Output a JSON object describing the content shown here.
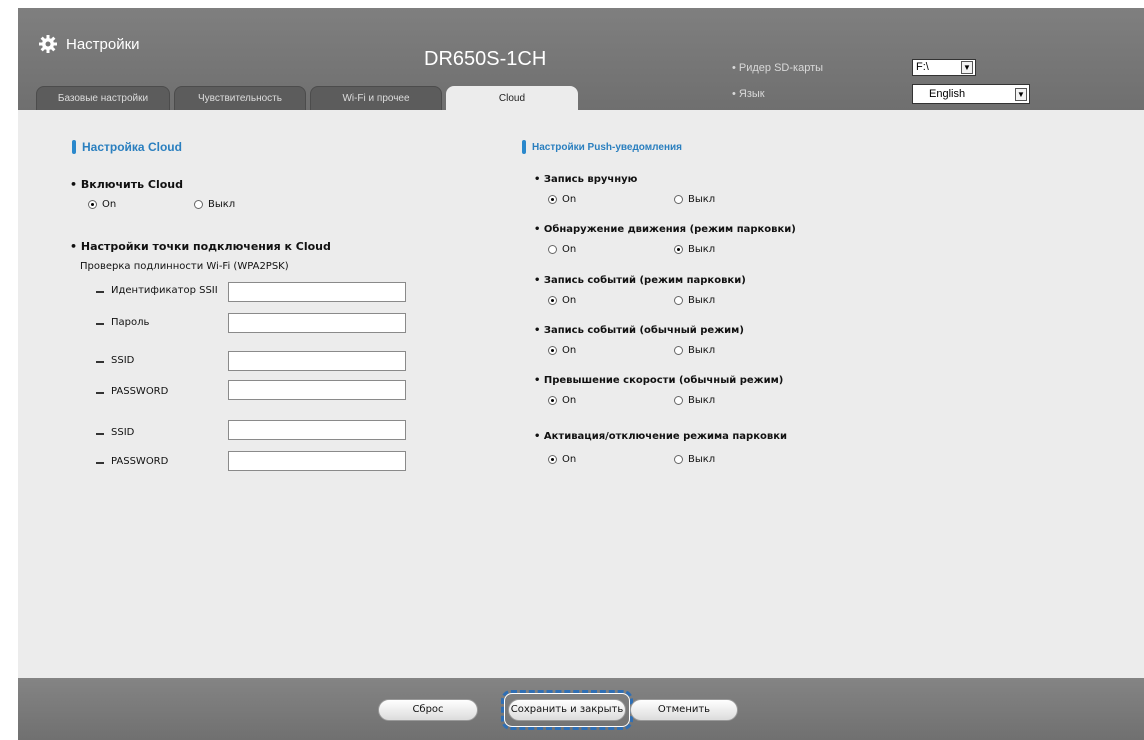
{
  "app": {
    "title": "Настройки",
    "device": "DR650S-1CH"
  },
  "tabs": [
    {
      "label": "Базовые настройки"
    },
    {
      "label": "Чувствительность"
    },
    {
      "label": "Wi-Fi и прочее"
    },
    {
      "label": "Cloud"
    }
  ],
  "header_options": {
    "sd_label": "• Ридер SD-карты",
    "sd_value": "F:\\",
    "lang_label": "• Язык",
    "lang_value": "English"
  },
  "left": {
    "title": "Настройка Cloud",
    "enable_label": "• Включить Cloud",
    "on": "On",
    "off": "Выкл",
    "ap_title": "• Настройки точки подключения к Cloud",
    "auth_note": "Проверка подлинности Wi-Fi (WPA2PSK)",
    "fields": [
      {
        "label": "Идентификатор SSII",
        "value": ""
      },
      {
        "label": "Пароль",
        "value": ""
      },
      {
        "label": "SSID",
        "value": ""
      },
      {
        "label": "PASSWORD",
        "value": ""
      },
      {
        "label": "SSID",
        "value": ""
      },
      {
        "label": "PASSWORD",
        "value": ""
      }
    ]
  },
  "right": {
    "title": "Настройки Push-уведомления",
    "on": "On",
    "off": "Выкл",
    "items": [
      {
        "label": "• Запись вручную",
        "selected": "On"
      },
      {
        "label": "• Обнаружение движения (режим парковки)",
        "selected": "Выкл"
      },
      {
        "label": "• Запись событий (режим парковки)",
        "selected": "On"
      },
      {
        "label": "• Запись событий (обычный режим)",
        "selected": "On"
      },
      {
        "label": "• Превышение скорости (обычный режим)",
        "selected": "On"
      },
      {
        "label": "• Активация/отключение режима парковки",
        "selected": "On"
      }
    ]
  },
  "footer": {
    "reset": "Сброс",
    "save": "Сохранить и закрыть",
    "cancel": "Отменить"
  }
}
